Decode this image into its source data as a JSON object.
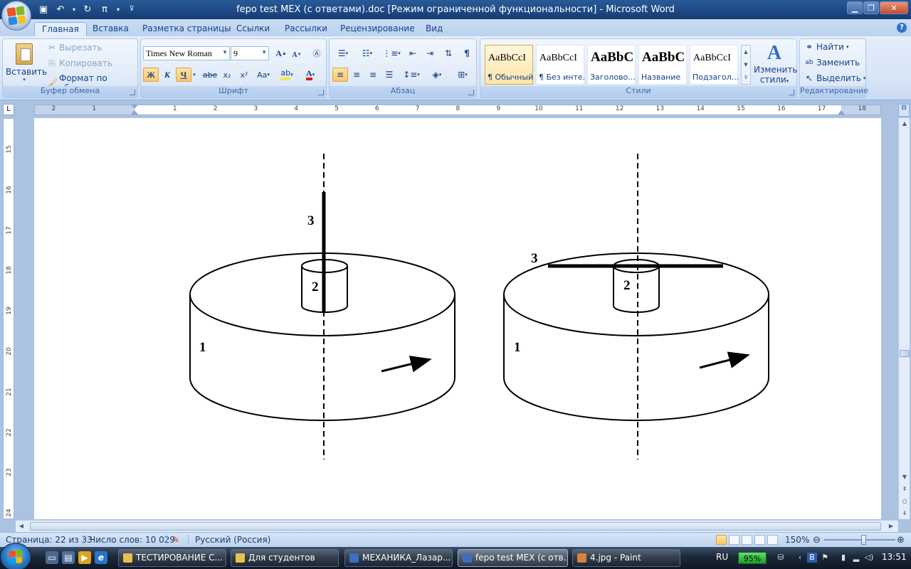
{
  "window": {
    "title": "fepo test MEX (с ответами).doc [Режим ограниченной функциональности]  -  Microsoft Word"
  },
  "ribbon": {
    "tabs": [
      "Главная",
      "Вставка",
      "Разметка страницы",
      "Ссылки",
      "Рассылки",
      "Рецензирование",
      "Вид"
    ],
    "clipboard": {
      "label": "Буфер обмена",
      "paste": "Вставить",
      "cut": "Вырезать",
      "copy": "Копировать",
      "format_painter": "Формат по образцу"
    },
    "font": {
      "label": "Шрифт",
      "font_name": "Times New Roman",
      "font_size": "9",
      "bold": "Ж",
      "italic": "К",
      "underline": "Ч",
      "strike": "abe",
      "subscript": "x₂",
      "superscript": "x²",
      "change_case": "Aa",
      "grow": "A",
      "shrink": "A"
    },
    "paragraph": {
      "label": "Абзац"
    },
    "styles": {
      "label": "Стили",
      "items": [
        {
          "sample": "AaBbCcI",
          "name": "¶ Обычный"
        },
        {
          "sample": "AaBbCcI",
          "name": "¶ Без инте..."
        },
        {
          "sample": "AaBbC",
          "name": "Заголово..."
        },
        {
          "sample": "AaBbC",
          "name": "Название"
        },
        {
          "sample": "AaBbCcI",
          "name": "Подзагол..."
        }
      ],
      "change_styles_line1": "Изменить",
      "change_styles_line2": "стили"
    },
    "editing": {
      "label": "Редактирование",
      "find": "Найти",
      "replace": "Заменить",
      "select": "Выделить"
    }
  },
  "ruler": {
    "left_numbers": [
      "2",
      "1"
    ],
    "right_numbers": [
      "1",
      "2",
      "3",
      "4",
      "5",
      "6",
      "7",
      "8",
      "9",
      "10",
      "11",
      "12",
      "13",
      "14",
      "15",
      "16",
      "17",
      "18"
    ],
    "tab_stop": "L",
    "vertical_numbers": [
      "15",
      "16",
      "17",
      "18",
      "19",
      "20",
      "21",
      "22",
      "23",
      "24"
    ]
  },
  "document": {
    "left_figure": {
      "label_1": "1",
      "label_2": "2",
      "label_3": "3"
    },
    "right_figure": {
      "label_1": "1",
      "label_2": "2",
      "label_3": "3"
    }
  },
  "statusbar": {
    "page": "Страница: 22 из 33",
    "words": "Число слов: 10 029",
    "language": "Русский (Россия)",
    "zoom": "150%"
  },
  "taskbar": {
    "tasks": [
      {
        "label": "ТЕСТИРОВАНИЕ С...",
        "icon_color": "#e8c14a"
      },
      {
        "label": "Для студентов",
        "icon_color": "#e8c14a"
      },
      {
        "label": "МЕХАНИКА_Лазар...",
        "icon_color": "#3c6fc4"
      },
      {
        "label": "fepo test MEX (с отв...",
        "icon_color": "#3c6fc4"
      },
      {
        "label": "4.jpg - Paint",
        "icon_color": "#d9823a"
      }
    ],
    "lang": "RU",
    "battery": "95%",
    "clock": "13:51"
  }
}
